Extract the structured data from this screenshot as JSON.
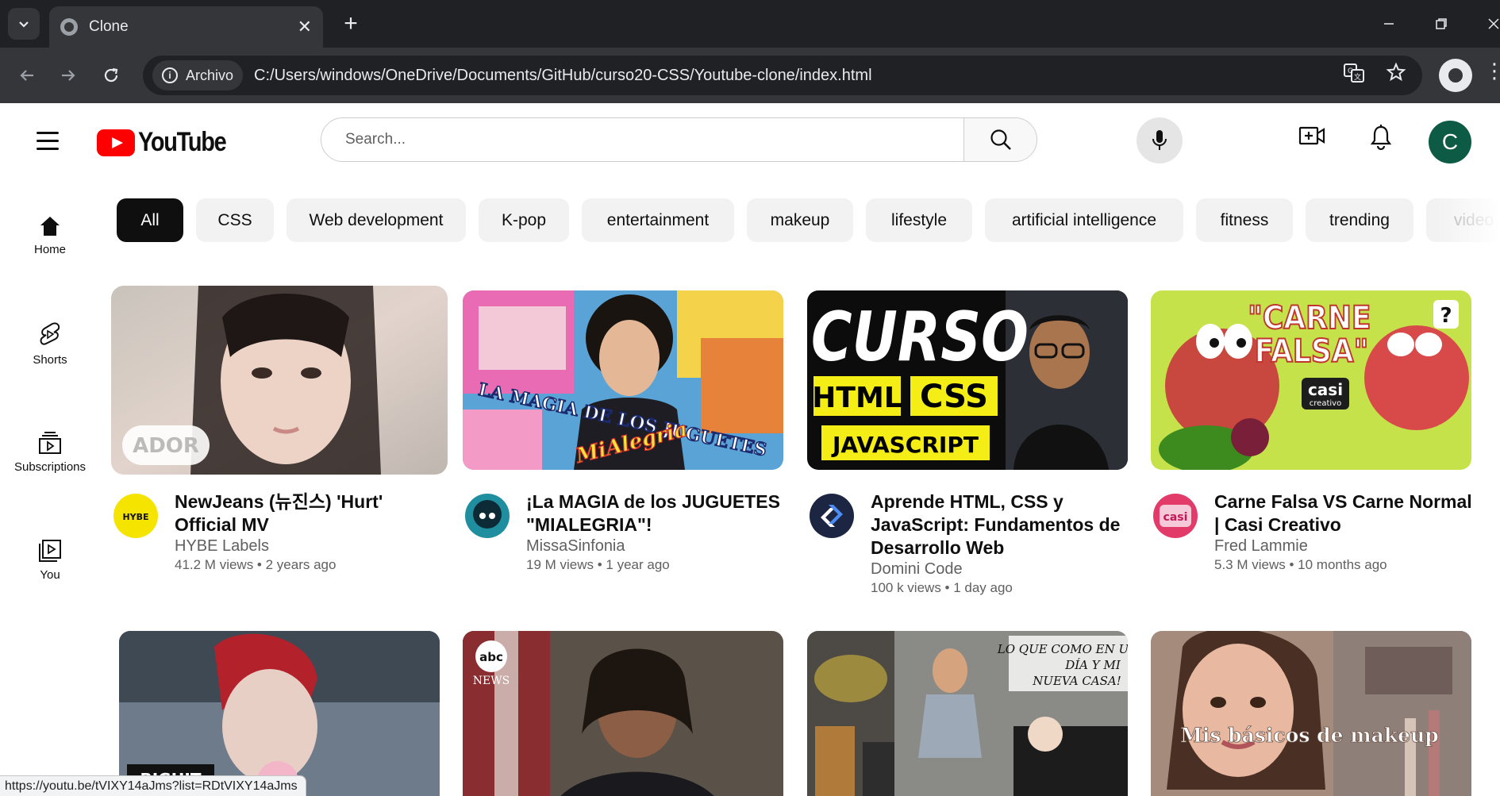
{
  "browser": {
    "tab_title": "Clone",
    "tab_close": "✕",
    "new_tab": "+",
    "file_chip": "Archivo",
    "url": "C:/Users/windows/OneDrive/Documents/GitHub/curso20-CSS/Youtube-clone/index.html",
    "status_url": "https://youtu.be/tVIXY14aJms?list=RDtVIXY14aJms"
  },
  "header": {
    "logo_text": "YouTube",
    "search_placeholder": "Search...",
    "avatar_letter": "C"
  },
  "sidebar": {
    "items": [
      {
        "label": "Home",
        "icon": "home-icon"
      },
      {
        "label": "Shorts",
        "icon": "shorts-icon"
      },
      {
        "label": "Subscriptions",
        "icon": "subscriptions-icon"
      },
      {
        "label": "You",
        "icon": "you-icon"
      }
    ]
  },
  "chips": [
    {
      "label": "All",
      "active": true
    },
    {
      "label": "CSS"
    },
    {
      "label": "Web development"
    },
    {
      "label": "K-pop"
    },
    {
      "label": "entertainment"
    },
    {
      "label": "makeup"
    },
    {
      "label": "lifestyle"
    },
    {
      "label": "artificial intelligence"
    },
    {
      "label": "fitness"
    },
    {
      "label": "trending"
    },
    {
      "label": "video"
    }
  ],
  "videos": [
    {
      "title": "NewJeans (뉴진스) 'Hurt' Official MV",
      "channel": "HYBE Labels",
      "stats": "41.2 M views • 2 years ago",
      "channel_avatar_text": "HYBE",
      "thumb_badge": "ADOR",
      "colors": {
        "thumb": "#d9c9c2",
        "avatar": "#f5e400"
      }
    },
    {
      "title": "¡La MAGIA de los JUGUETES \"MIALEGRIA\"!",
      "channel": "MissaSinfonia",
      "stats": "19 M views • 1 year ago",
      "thumb_text": "LA MAGIA DE LOS JUGUETES",
      "thumb_text2": "MiAlegria",
      "colors": {
        "thumb": "#5aa3d6",
        "avatar": "#1f8fa0"
      }
    },
    {
      "title": "Aprende HTML, CSS y JavaScript: Fundamentos de Desarrollo Web",
      "channel": "Domini Code",
      "stats": "100 k views • 1 day ago",
      "thumb_lines": [
        "CURSO",
        "HTML",
        "CSS",
        "JAVASCRIPT"
      ],
      "colors": {
        "thumb": "#0c0c0c",
        "avatar": "#1c2541"
      }
    },
    {
      "title": "Carne Falsa VS Carne Normal | Casi Creativo",
      "channel": "Fred Lammie",
      "stats": "5.3 M views • 10 months ago",
      "thumb_lines": [
        "\"CARNE",
        "FALSA\"",
        "casi",
        "creativo",
        "?"
      ],
      "channel_avatar_text": "casi",
      "colors": {
        "thumb": "#c5e24a",
        "avatar": "#e23b6a"
      }
    },
    {
      "title": "",
      "channel": "",
      "stats": "",
      "thumb_text": "BIGHIT",
      "colors": {
        "thumb": "#6d7b8a"
      }
    },
    {
      "title": "",
      "channel": "",
      "stats": "",
      "thumb_text": "abc",
      "thumb_text2": "NEWS",
      "colors": {
        "thumb": "#5a5148"
      }
    },
    {
      "title": "",
      "channel": "",
      "stats": "",
      "thumb_lines": [
        "LO QUE COMO EN UN",
        "DÍA Y MI",
        "NUEVA CASA!"
      ],
      "colors": {
        "thumb": "#8a8a86"
      }
    },
    {
      "title": "",
      "channel": "",
      "stats": "",
      "thumb_text": "Mis básicos de makeup",
      "colors": {
        "thumb": "#a48b7c"
      }
    }
  ]
}
